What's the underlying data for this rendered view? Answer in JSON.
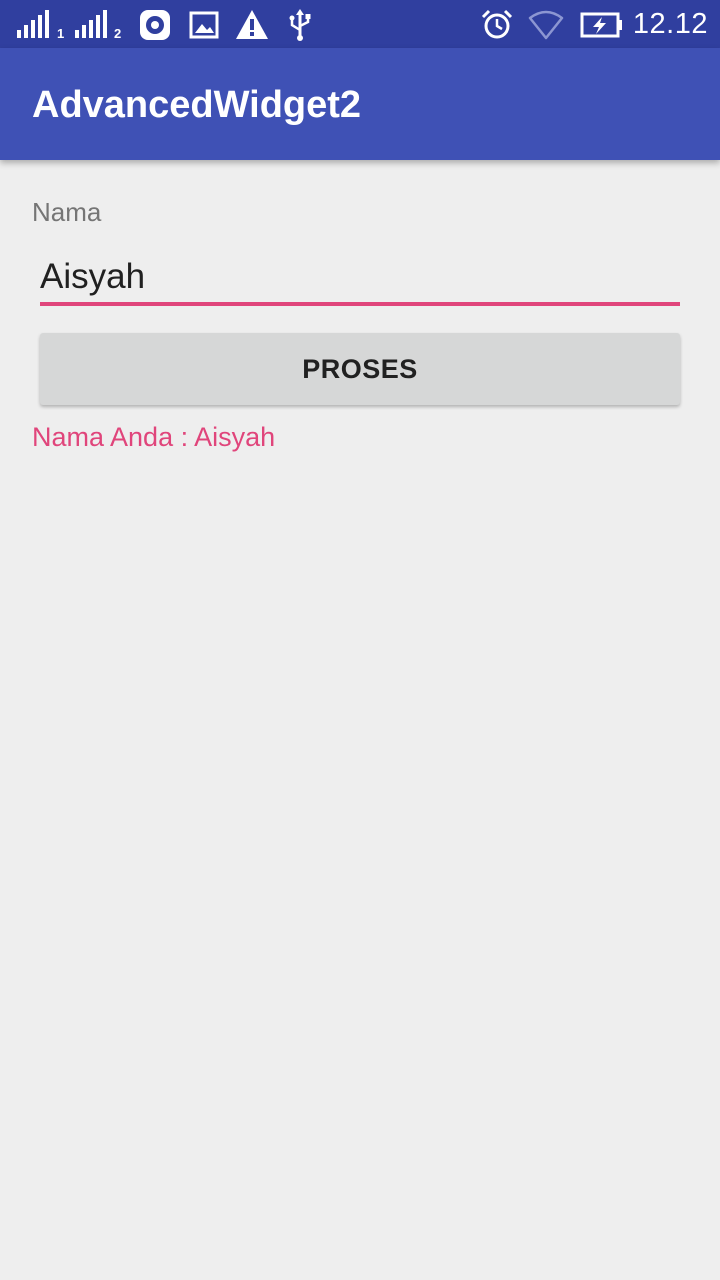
{
  "status_bar": {
    "sim1_label": "1",
    "sim2_label": "2",
    "time": "12.12",
    "icons": [
      "signal-sim1-icon",
      "signal-sim2-icon",
      "record-app-icon",
      "image-notification-icon",
      "warning-icon",
      "usb-icon",
      "alarm-icon",
      "wifi-icon",
      "battery-charging-icon"
    ]
  },
  "app_bar": {
    "title": "AdvancedWidget2"
  },
  "form": {
    "name_label": "Nama",
    "name_value": "Aisyah",
    "button_label": "PROSES",
    "result_text": "Nama Anda : Aisyah"
  },
  "colors": {
    "status_bar": "#303f9f",
    "app_bar": "#3f51b5",
    "accent": "#e0457b",
    "background": "#eeeeee"
  }
}
